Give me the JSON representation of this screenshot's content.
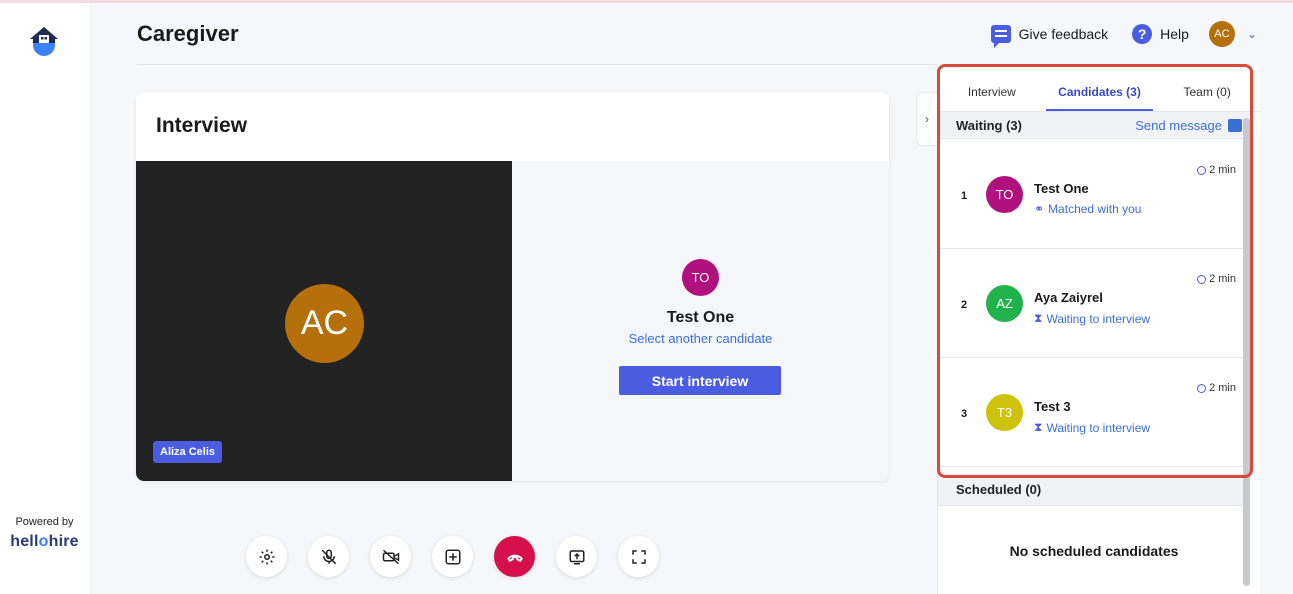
{
  "app": {
    "title": "Caregiver",
    "powered_by": "Powered by",
    "brand_part1": "hell",
    "brand_part2": "o",
    "brand_part3": "hire"
  },
  "header": {
    "feedback_label": "Give feedback",
    "help_label": "Help",
    "avatar_initials": "AC"
  },
  "interview": {
    "title": "Interview",
    "self_initials": "AC",
    "self_name": "Aliza Celis",
    "candidate_initials": "TO",
    "candidate_name": "Test One",
    "select_another": "Select another candidate",
    "start_button": "Start interview"
  },
  "panel": {
    "tabs": [
      {
        "label": "Interview"
      },
      {
        "label": "Candidates (3)"
      },
      {
        "label": "Team (0)"
      }
    ],
    "waiting_header": "Waiting (3)",
    "send_message": "Send message",
    "candidates": [
      {
        "num": "1",
        "initials": "TO",
        "name": "Test One",
        "status": "Matched with you",
        "time": "2 min",
        "color": "#b0117e",
        "status_icon": "matched-icon"
      },
      {
        "num": "2",
        "initials": "AZ",
        "name": "Aya Zaiyrel",
        "status": "Waiting to interview",
        "time": "2 min",
        "color": "#22b24c",
        "status_icon": "hourglass-icon"
      },
      {
        "num": "3",
        "initials": "T3",
        "name": "Test 3",
        "status": "Waiting to interview",
        "time": "2 min",
        "color": "#cfc20a",
        "status_icon": "hourglass-icon"
      }
    ],
    "scheduled_header": "Scheduled (0)",
    "no_scheduled": "No scheduled candidates"
  },
  "colors": {
    "accent": "#4a5de0",
    "end_call": "#d6104a",
    "highlight": "#d9493c"
  }
}
